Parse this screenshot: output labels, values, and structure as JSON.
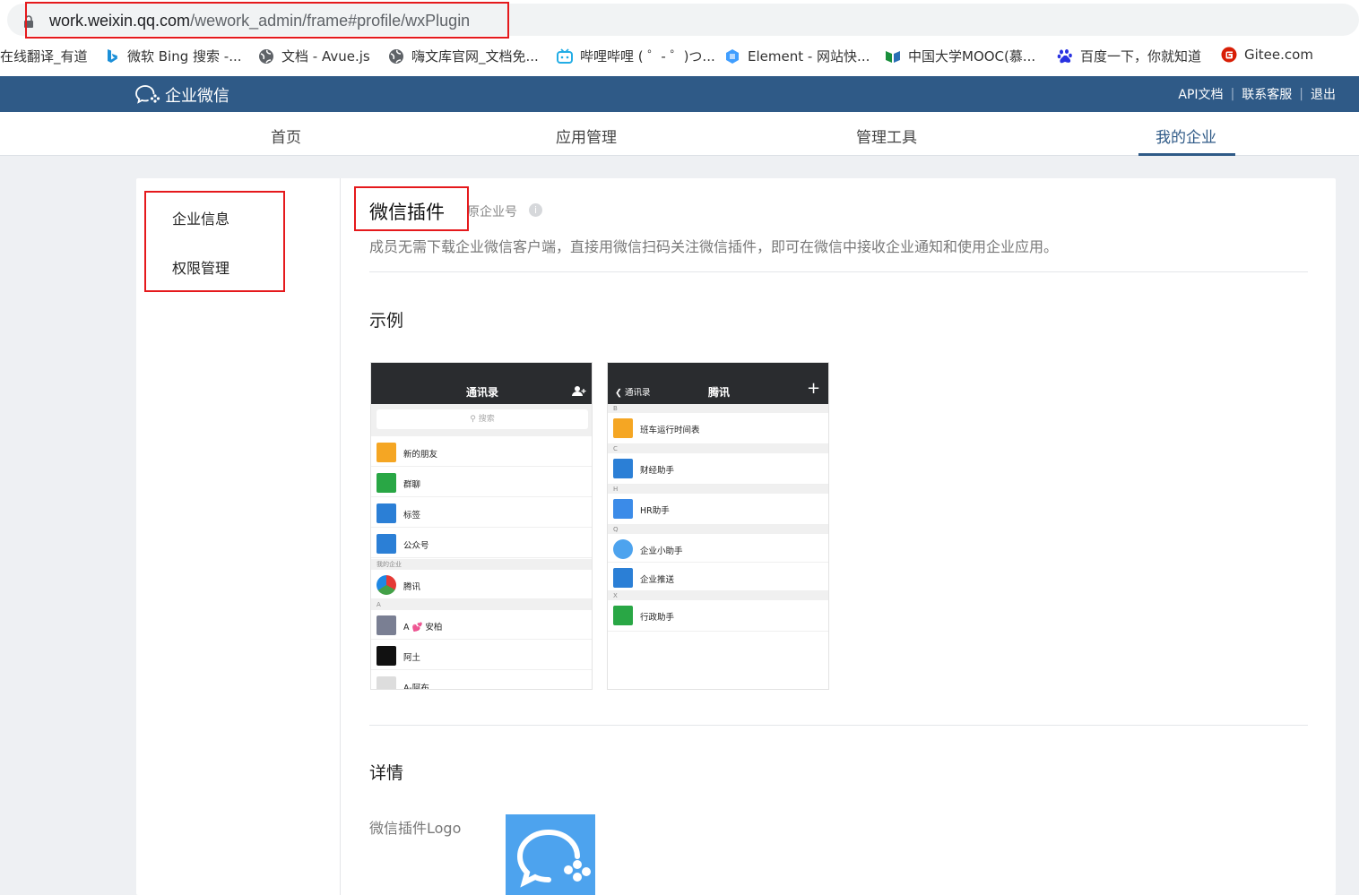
{
  "browser": {
    "url_host": "work.weixin.qq.com",
    "url_path": "/wework_admin/frame#profile/wxPlugin",
    "bookmarks": [
      {
        "label": "在线翻译_有道",
        "icon": "none"
      },
      {
        "label": "微软 Bing 搜索 -...",
        "icon": "bing-icon"
      },
      {
        "label": "文档 - Avue.js",
        "icon": "globe-icon"
      },
      {
        "label": "嗨文库官网_文档免...",
        "icon": "globe-icon"
      },
      {
        "label": "哔哩哔哩 ( ゜- ゜)つ...",
        "icon": "bilibili-icon"
      },
      {
        "label": "Element - 网站快...",
        "icon": "element-icon"
      },
      {
        "label": "中国大学MOOC(慕...",
        "icon": "mooc-icon"
      },
      {
        "label": "百度一下，你就知道",
        "icon": "baidu-icon"
      },
      {
        "label": "Gitee.com",
        "icon": "gitee-icon"
      }
    ]
  },
  "header": {
    "logo_text": "企业微信",
    "links": [
      "API文档",
      "联系客服",
      "退出"
    ]
  },
  "nav": {
    "tabs": [
      "首页",
      "应用管理",
      "管理工具",
      "我的企业"
    ],
    "active": "我的企业"
  },
  "sidebar": {
    "items": [
      "企业信息",
      "权限管理"
    ]
  },
  "main": {
    "title": "微信插件",
    "title_suffix": "原企业号",
    "description": "成员无需下载企业微信客户端，直接用微信扫码关注微信插件，即可在微信中接收企业通知和使用企业应用。",
    "example_heading": "示例",
    "details_heading": "详情",
    "logo_label": "微信插件Logo"
  },
  "phone1": {
    "title": "通讯录",
    "search_placeholder": "搜索",
    "rows": [
      "新的朋友",
      "群聊",
      "标签",
      "公众号"
    ],
    "section_mycorp": "我的企业",
    "corp_row": "腾讯",
    "section_a": "A",
    "contacts": [
      "A 💕 安柏",
      "阿土",
      "A-阿布"
    ]
  },
  "phone2": {
    "back_label": "通讯录",
    "title": "腾讯",
    "sections": [
      "B",
      "C",
      "H",
      "Q",
      "X"
    ],
    "rows": [
      "班车运行时间表",
      "财经助手",
      "HR助手",
      "企业小助手",
      "企业推送",
      "行政助手"
    ]
  },
  "colors": {
    "header_bg": "#2f5a87",
    "highlight_red": "#e5191c",
    "logo_blue": "#4da3ee"
  }
}
